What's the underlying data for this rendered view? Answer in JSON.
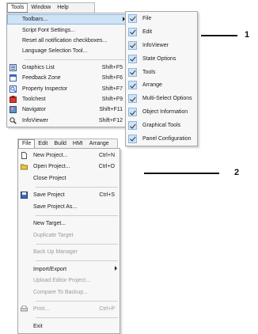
{
  "top_menubar": {
    "items": [
      "Tools",
      "Window",
      "Help"
    ]
  },
  "tools_menu": {
    "items": [
      {
        "label": "Toolbars...",
        "shortcut": "",
        "icon": "none"
      },
      {
        "label": "Script Font Settings...",
        "shortcut": "",
        "icon": "none"
      },
      {
        "label": "Reset all notification checkboxes...",
        "shortcut": "",
        "icon": "none"
      },
      {
        "label": "Language Selection Tool...",
        "shortcut": "",
        "icon": "none"
      },
      {
        "label": "Graphics List",
        "shortcut": "Shift+F5",
        "icon": "graphics-list-icon"
      },
      {
        "label": "Feedback Zone",
        "shortcut": "Shift+F6",
        "icon": "feedback-zone-icon"
      },
      {
        "label": "Property Inspector",
        "shortcut": "Shift+F7",
        "icon": "property-inspector-icon"
      },
      {
        "label": "Toolchest",
        "shortcut": "Shift+F9",
        "icon": "toolchest-icon"
      },
      {
        "label": "Navigator",
        "shortcut": "Shift+F11",
        "icon": "navigator-icon"
      },
      {
        "label": "InfoViewer",
        "shortcut": "Shift+F12",
        "icon": "infoviewer-icon"
      }
    ]
  },
  "toolbars_submenu": {
    "items": [
      {
        "label": "File"
      },
      {
        "label": "Edit"
      },
      {
        "label": "InfoViewer"
      },
      {
        "label": "State Options"
      },
      {
        "label": "Tools"
      },
      {
        "label": "Arrange"
      },
      {
        "label": "Multi-Select Options"
      },
      {
        "label": "Object Information"
      },
      {
        "label": "Graphical Tools"
      },
      {
        "label": "Panel Configuration"
      }
    ]
  },
  "callout_1": "1",
  "bottom_menubar": {
    "items": [
      "File",
      "Edit",
      "Build",
      "HMI",
      "Arrange"
    ]
  },
  "file_menu": {
    "groups": [
      [
        {
          "label": "New Project...",
          "shortcut": "Ctrl+N",
          "icon": "new-project-icon"
        },
        {
          "label": "Open Project...",
          "shortcut": "Ctrl+O",
          "icon": "open-project-icon"
        },
        {
          "label": "Close Project",
          "shortcut": "",
          "icon": "none"
        }
      ],
      [
        {
          "label": "Save Project",
          "shortcut": "Ctrl+S",
          "icon": "save-icon"
        },
        {
          "label": "Save Project As...",
          "shortcut": "",
          "icon": "none"
        }
      ],
      [
        {
          "label": "New Target...",
          "shortcut": "",
          "icon": "none"
        },
        {
          "label": "Duplicate Target",
          "shortcut": "",
          "icon": "none",
          "disabled": true
        }
      ],
      [
        {
          "label": "Back Up Manager",
          "shortcut": "",
          "icon": "none",
          "disabled": true
        }
      ],
      [
        {
          "label": "Import/Export",
          "shortcut": "",
          "icon": "none",
          "submenu": true
        },
        {
          "label": "Upload Editor Project...",
          "shortcut": "",
          "icon": "none",
          "disabled": true
        },
        {
          "label": "Compare To Backup...",
          "shortcut": "",
          "icon": "none",
          "disabled": true
        }
      ],
      [
        {
          "label": "Print...",
          "shortcut": "Ctrl+P",
          "icon": "print-icon",
          "disabled": true
        }
      ],
      [
        {
          "label": "Exit",
          "shortcut": "",
          "icon": "none"
        }
      ]
    ]
  },
  "callout_2": "2"
}
